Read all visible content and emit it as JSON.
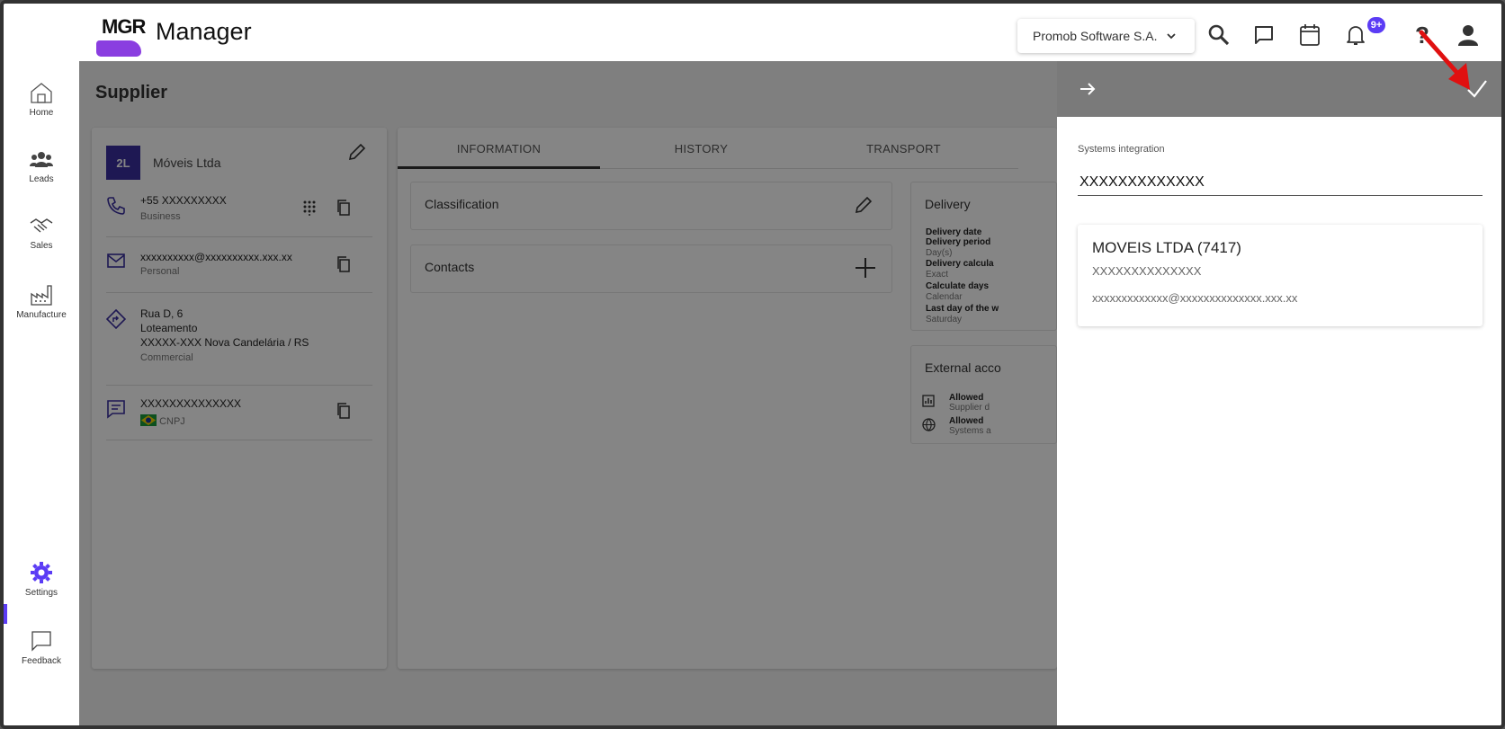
{
  "app": {
    "logo_text": "MGR",
    "title": "Manager"
  },
  "topbar": {
    "company": "Promob Software S.A.",
    "icons": [
      "search-icon",
      "chat-icon",
      "calendar-icon",
      "bell-icon",
      "help-icon",
      "account-icon"
    ],
    "notification_badge": "9+"
  },
  "sidebar": {
    "items": [
      {
        "label": "Home",
        "icon": "home-icon"
      },
      {
        "label": "Leads",
        "icon": "people-icon"
      },
      {
        "label": "Sales",
        "icon": "handshake-icon"
      },
      {
        "label": "Manufacture",
        "icon": "factory-icon"
      },
      {
        "label": "Settings",
        "icon": "gear-icon",
        "active": true
      },
      {
        "label": "Feedback",
        "icon": "feedback-icon"
      }
    ]
  },
  "page": {
    "title": "Supplier"
  },
  "supplier": {
    "avatar": "2L",
    "name": "Móveis Ltda",
    "phone": "+55 XXXXXXXXX",
    "phone_type": "Business",
    "email": "xxxxxxxxxx@xxxxxxxxxx.xxx.xx",
    "email_type": "Personal",
    "address_line1": "Rua D, 6",
    "address_line2": "Loteamento",
    "address_line3": "XXXXX-XXX Nova Candelária / RS",
    "address_type": "Commercial",
    "document": "XXXXXXXXXXXXXX",
    "document_type": "CNPJ"
  },
  "tabs": [
    "INFORMATION",
    "HISTORY",
    "TRANSPORT"
  ],
  "sections": {
    "classification": "Classification",
    "contacts": "Contacts",
    "delivery": {
      "title": "Delivery",
      "rows": [
        {
          "label": "Delivery date",
          "value": ""
        },
        {
          "label": "Delivery period",
          "value": "Day(s)"
        },
        {
          "label": "Delivery calcula",
          "value": "Exact"
        },
        {
          "label": "Calculate days",
          "value": "Calendar"
        },
        {
          "label": "Last day of the w",
          "value": "Saturday"
        }
      ]
    },
    "external": {
      "title": "External acco",
      "rows": [
        {
          "label": "Allowed",
          "value": "Supplier d"
        },
        {
          "label": "Allowed",
          "value": "Systems a"
        }
      ]
    }
  },
  "panel": {
    "field_label": "Systems integration",
    "field_value": "XXXXXXXXXXXXX",
    "result": {
      "title": "MOVEIS LTDA (7417)",
      "subtitle": "XXXXXXXXXXXXXX",
      "email": "xxxxxxxxxxxxx@xxxxxxxxxxxxxx.xxx.xx"
    }
  },
  "colors": {
    "accent": "#5b3cf5",
    "panel_header": "#7a7a7a",
    "annotation": "#e01010"
  }
}
